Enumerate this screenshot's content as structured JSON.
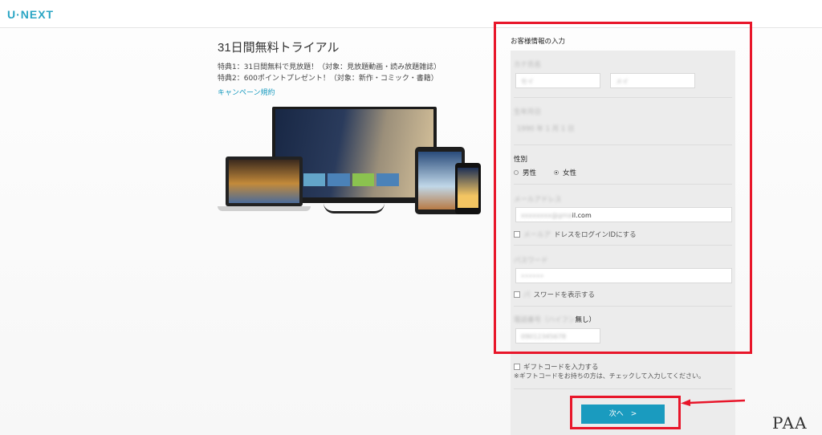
{
  "header": {
    "logo": "U·NEXT"
  },
  "campaign": {
    "title": "31日間無料トライアル",
    "perk1": "特典1：31日間無料で見放題！（対象：見放題動画・読み放題雑誌）",
    "perk2": "特典2：600ポイントプレゼント！（対象：新作・コミック・書籍）",
    "link": "キャンペーン規約"
  },
  "form": {
    "heading": "お客様情報の入力",
    "name_label": "カナ氏名",
    "name_sei": "セイ",
    "name_mei": "メイ",
    "birth_label": "生年月日",
    "birth_value": "1990 年 1 月 1 日",
    "gender_label": "性別",
    "gender_male": "男性",
    "gender_female": "女性",
    "email_label": "メールアドレス",
    "email_value_blurred": "xxxxxxxx@gma",
    "email_value": "il.com",
    "email_login_blurred": "メールア",
    "email_login": "ドレスをログインIDにする",
    "password_label": "パスワード",
    "password_placeholder": "••••••",
    "password_show_blurred": "パ",
    "password_show": "スワードを表示する",
    "phone_label_blurred": "電話番号（ハイフン",
    "phone_label": "無し）",
    "phone_value": "09012345678",
    "gift_label": "ギフトコードを入力する",
    "gift_note": "※ギフトコードをお持ちの方は、チェックして入力してください。",
    "next_button": "次へ　>"
  },
  "watermark": "PAA",
  "colors": {
    "accent": "#1a9bbf",
    "highlight": "#e8162a"
  }
}
